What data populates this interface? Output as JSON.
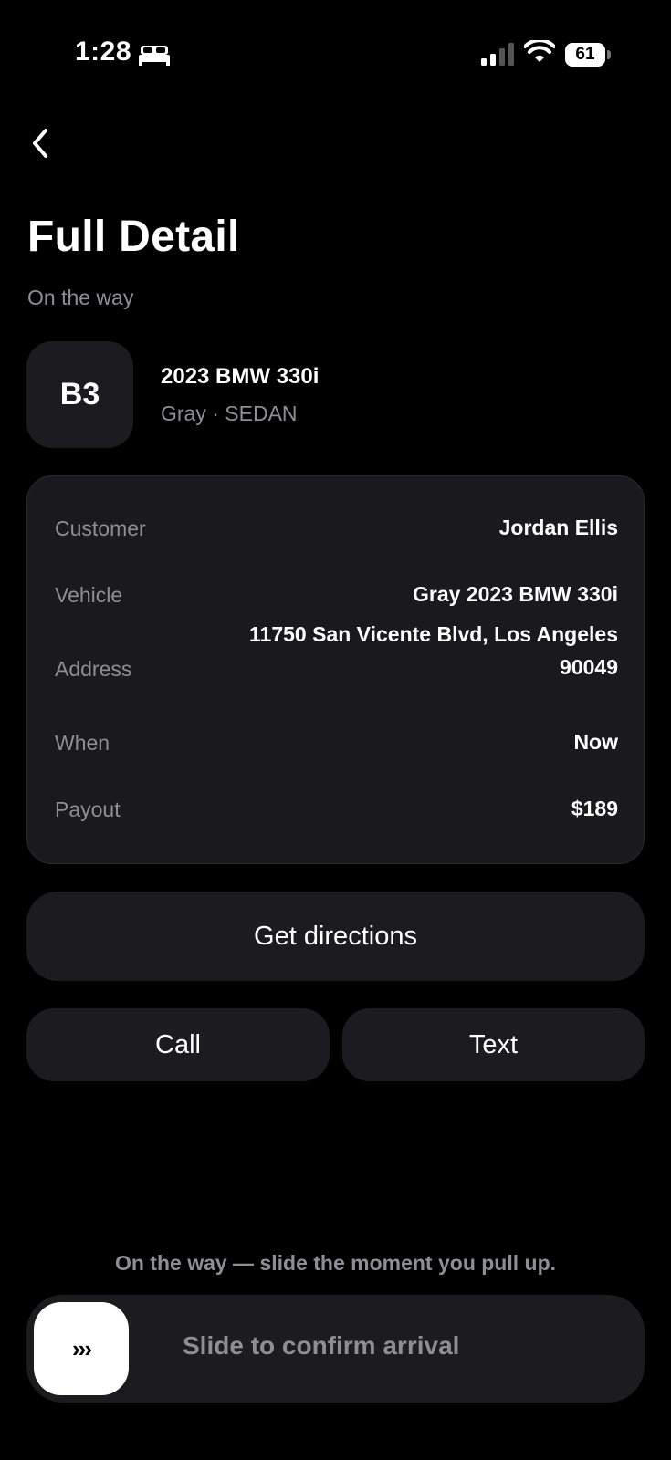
{
  "status_bar": {
    "time": "1:28",
    "battery": "61"
  },
  "header": {
    "title": "Full Detail",
    "status": "On the way"
  },
  "vehicle": {
    "spot": "B3",
    "name": "2023 BMW 330i",
    "details": "Gray · SEDAN"
  },
  "details": {
    "customer_label": "Customer",
    "customer_value": "Jordan Ellis",
    "vehicle_label": "Vehicle",
    "vehicle_value": "Gray 2023 BMW 330i",
    "address_label": "Address",
    "address_line1": "11750 San Vicente Blvd, Los Angeles",
    "address_line2": "90049",
    "when_label": "When",
    "when_value": "Now",
    "payout_label": "Payout",
    "payout_value": "$189"
  },
  "actions": {
    "directions": "Get directions",
    "call": "Call",
    "text": "Text"
  },
  "footer": {
    "hint": "On the way — slide the moment you pull up.",
    "knob": "›››",
    "slider_label": "Slide to confirm arrival"
  },
  "icons": {
    "back": "chevron-left-icon",
    "bed": "bed-icon",
    "signal": "cellular-signal-icon",
    "wifi": "wifi-icon",
    "battery": "battery-icon"
  }
}
